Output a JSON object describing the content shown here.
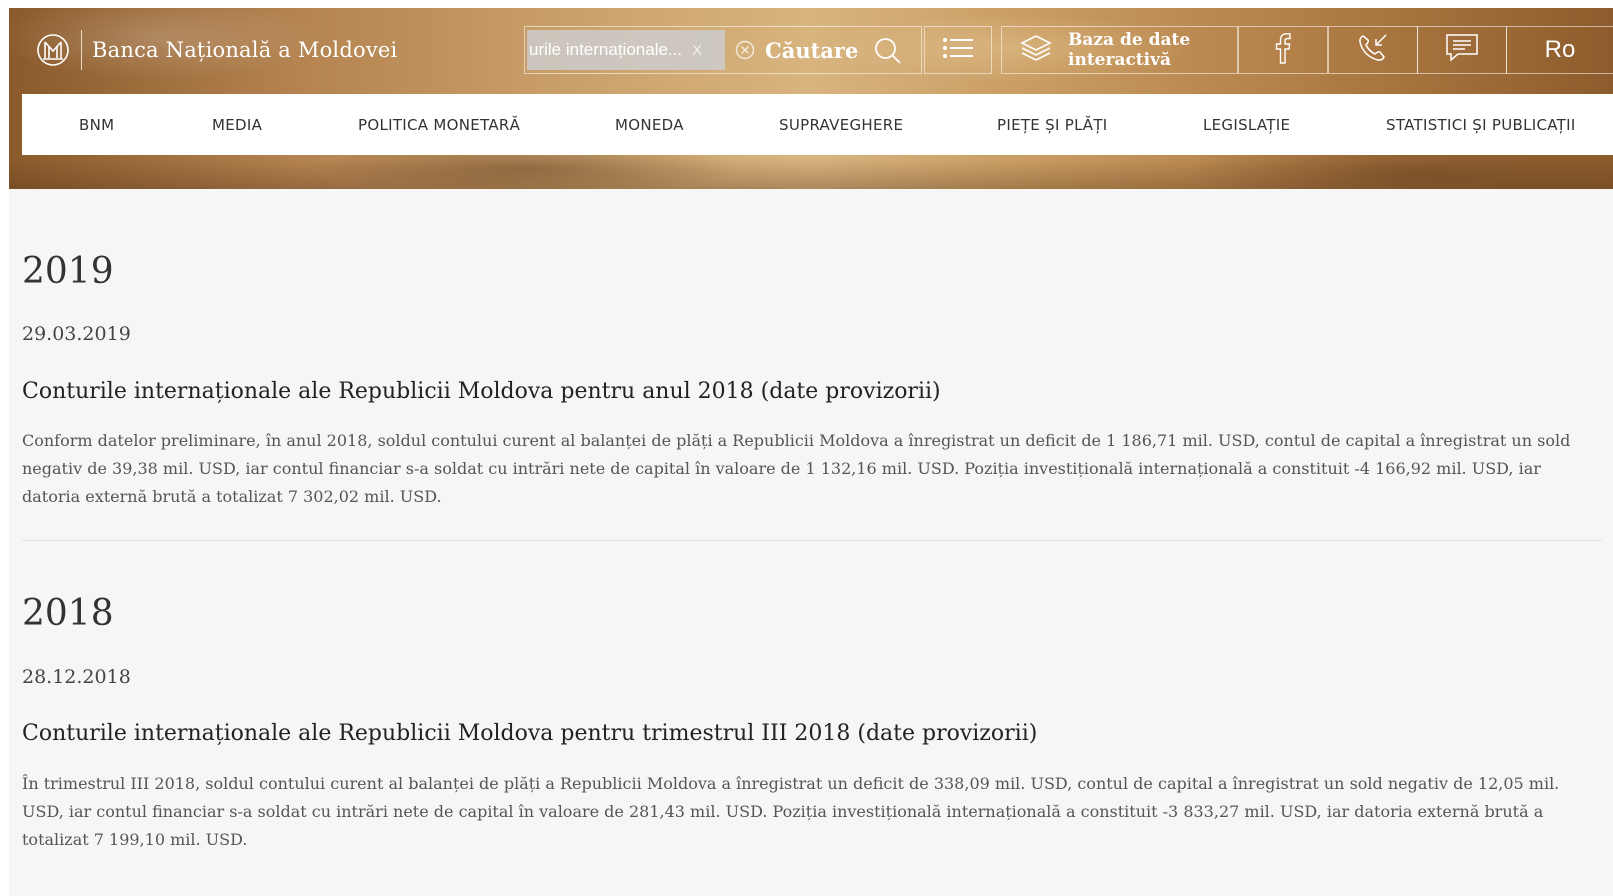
{
  "header": {
    "logo_text": "Banca Națională a Moldovei",
    "search": {
      "chip_text": "urile internaționale...",
      "chip_remove": "X",
      "label": "Căutare"
    },
    "database_label_line1": "Baza de date",
    "database_label_line2": "interactivă",
    "language": "Ro"
  },
  "nav": {
    "items": [
      {
        "label": "BNM"
      },
      {
        "label": "MEDIA"
      },
      {
        "label": "POLITICA MONETARĂ"
      },
      {
        "label": "MONEDA"
      },
      {
        "label": "SUPRAVEGHERE"
      },
      {
        "label": "PIEȚE ȘI PLĂȚI"
      },
      {
        "label": "LEGISLAȚIE"
      },
      {
        "label": "STATISTICI ȘI PUBLICAȚII"
      }
    ]
  },
  "sections": [
    {
      "year": "2019",
      "date": "29.03.2019",
      "title": "Conturile internaționale ale Republicii Moldova pentru anul 2018 (date provizorii)",
      "body": "Conform datelor preliminare, în anul 2018, soldul contului curent al balanței de plăți a Republicii Moldova a înregistrat un deficit de 1 186,71 mil. USD, contul de capital a înregistrat un sold negativ de 39,38 mil. USD, iar contul financiar s-a soldat cu intrări nete de capital în valoare de 1 132,16 mil. USD. Poziția investițională internațională a constituit -4 166,92 mil. USD, iar datoria externă brută a totalizat 7 302,02 mil. USD."
    },
    {
      "year": "2018",
      "date": "28.12.2018",
      "title": "Conturile internaționale ale Republicii Moldova pentru trimestrul III 2018 (date provizorii)",
      "body": "În trimestrul III 2018, soldul contului curent al balanței de plăți a Republicii Moldova a înregistrat un deficit de 338,09 mil. USD, contul de capital a înregistrat un sold negativ de 12,05 mil. USD, iar contul financiar s-a soldat cu intrări nete de capital în valoare de 281,43 mil. USD. Poziția investițională internațională a constituit -3 833,27 mil. USD, iar datoria externă brută a totalizat 7 199,10 mil. USD."
    }
  ],
  "icons": {
    "logo": "bnm-logo-icon",
    "clear": "clear-circle-icon",
    "search": "search-icon",
    "menu": "list-icon",
    "database": "layers-icon",
    "facebook": "facebook-icon",
    "phone": "phone-icon",
    "message": "chat-icon"
  }
}
